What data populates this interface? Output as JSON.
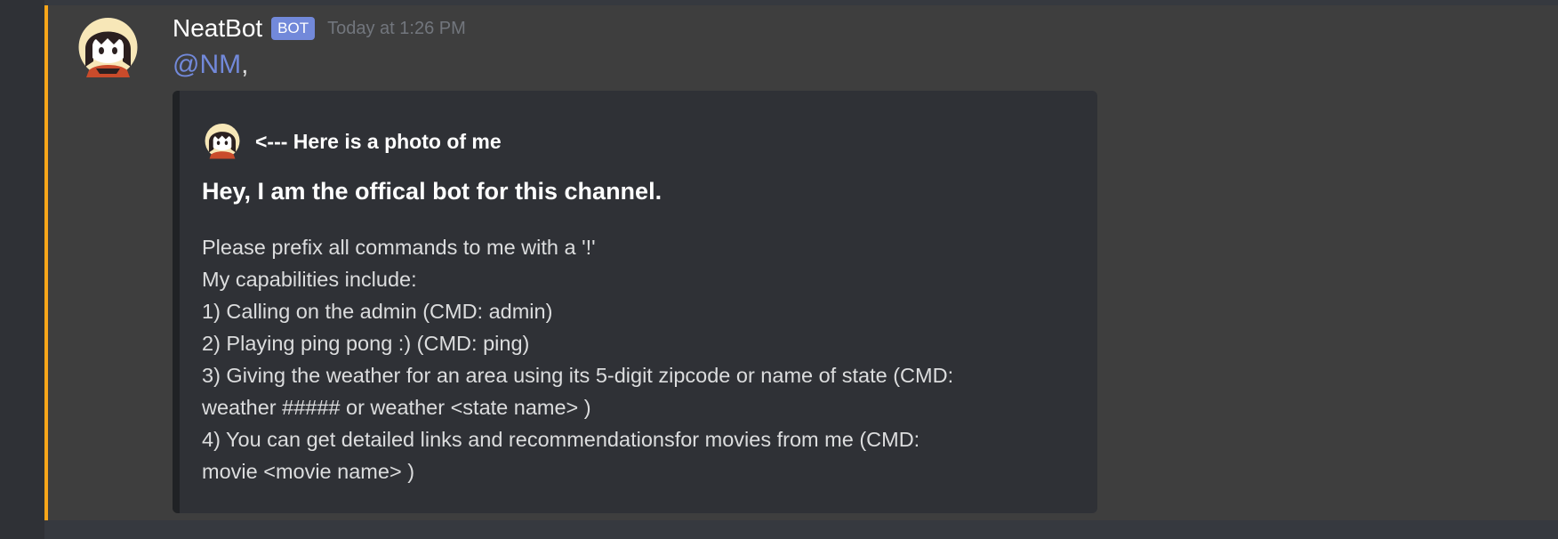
{
  "message": {
    "author": "NeatBot",
    "bot_tag": "BOT",
    "timestamp": "Today at 1:26 PM",
    "mention": "@NM",
    "mention_suffix": ","
  },
  "embed": {
    "author_name": "<--- Here is a photo of me",
    "title": "Hey, I am the offical bot for this channel.",
    "description_lines": [
      "Please prefix all commands to me with a '!'",
      "My capabilities include:",
      "1) Calling on the admin (CMD: admin)",
      "2) Playing ping pong :) (CMD: ping)",
      "3) Giving the weather for an area using its 5-digit zipcode or name of state (CMD:",
      "weather ##### or weather <state name> )",
      "4) You can get detailed links and recommendationsfor movies from me (CMD:",
      "movie <movie name> )"
    ]
  },
  "colors": {
    "background": "#36393f",
    "message_highlight": "#3e3e3e",
    "mention_bar": "#faa61a",
    "mention_text": "#7289da",
    "bot_tag": "#7289da",
    "embed_background": "#2f3136"
  },
  "icons": {
    "avatar": "anime-girl-avatar-icon",
    "embed_author": "anime-girl-avatar-icon"
  }
}
